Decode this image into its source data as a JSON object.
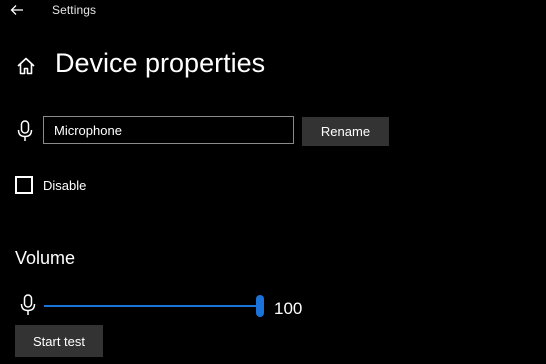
{
  "titlebar": {
    "back_icon": "back-arrow-icon",
    "title": "Settings"
  },
  "header": {
    "home_icon": "home-icon",
    "title": "Device properties"
  },
  "name_row": {
    "icon": "microphone-icon",
    "value": "Microphone",
    "rename_label": "Rename"
  },
  "disable": {
    "label": "Disable",
    "checked": false
  },
  "volume": {
    "heading": "Volume",
    "icon": "microphone-icon",
    "value": "100",
    "level_percent": 100,
    "start_test_label": "Start test"
  },
  "colors": {
    "background": "#000000",
    "accent": "#1a73d9",
    "button": "#333333",
    "input_border": "#8a8a8a",
    "track": "#5a5a5a"
  }
}
